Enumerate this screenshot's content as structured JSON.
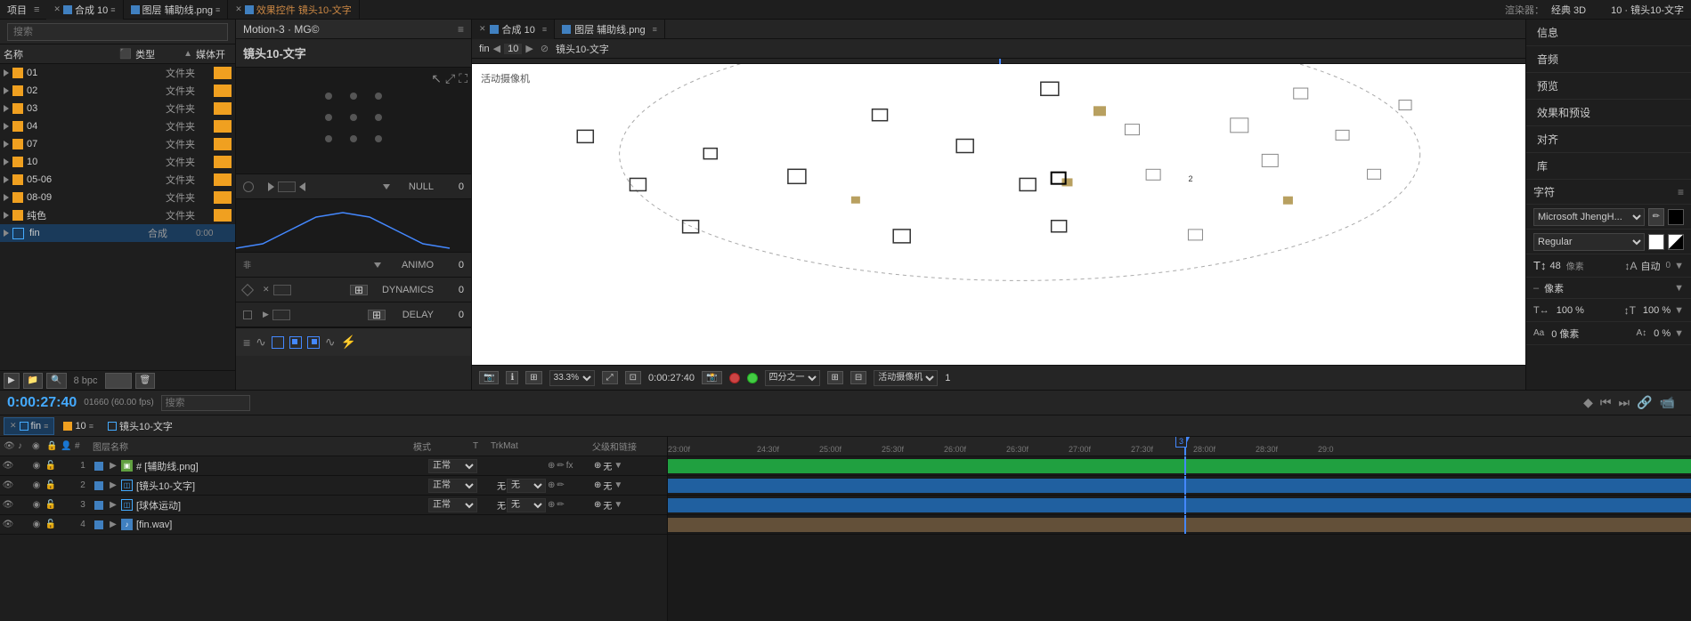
{
  "app": {
    "title": "After Effects"
  },
  "top_tabs": [
    {
      "id": "compose10",
      "label": "合成 10",
      "active": true,
      "icon": "◼"
    },
    {
      "id": "assist_line",
      "label": "图层 辅助线.png",
      "active": false,
      "icon": "◼"
    },
    {
      "id": "effects_lens10",
      "label": "效果控件 镜头10-文字",
      "active": false,
      "icon": "◼"
    }
  ],
  "left_panel": {
    "title": "项目",
    "search_placeholder": "搜索",
    "col_name": "名称",
    "col_type": "类型",
    "col_media": "媒体开",
    "files": [
      {
        "num": "01",
        "name": "01",
        "type": "文件夹",
        "color": "yellow"
      },
      {
        "num": "02",
        "name": "02",
        "type": "文件夹",
        "color": "yellow"
      },
      {
        "num": "03",
        "name": "03",
        "type": "文件夹",
        "color": "yellow"
      },
      {
        "num": "04",
        "name": "04",
        "type": "文件夹",
        "color": "yellow"
      },
      {
        "num": "07",
        "name": "07",
        "type": "文件夹",
        "color": "yellow"
      },
      {
        "num": "10",
        "name": "10",
        "type": "文件夹",
        "color": "yellow"
      },
      {
        "num": "05-06",
        "name": "05-06",
        "type": "文件夹",
        "color": "yellow"
      },
      {
        "num": "08-09",
        "name": "08-09",
        "type": "文件夹",
        "color": "yellow"
      },
      {
        "num": "pure_color",
        "name": "纯色",
        "type": "文件夹",
        "color": "yellow"
      },
      {
        "num": "fin",
        "name": "fin",
        "type": "合成",
        "color": "blue",
        "duration": "0:00"
      }
    ],
    "bottom_info": "8 bpc"
  },
  "motion_panel": {
    "title": "Motion-3 · MG©",
    "comp_name": "镜头10-文字",
    "null_label": "NULL",
    "animo_label": "ANIMO",
    "dynamics_label": "DYNAMICS",
    "delay_label": "DELAY",
    "values": {
      "null_val": "0",
      "animo_val": "0",
      "dynamics_val": "0",
      "delay_val": "0"
    }
  },
  "preview_panel": {
    "tabs": [
      {
        "id": "compose10",
        "label": "合成 10",
        "active": true
      },
      {
        "id": "assist_line",
        "label": "图层 辅助线.png",
        "active": false
      }
    ],
    "toolbar": {
      "fin_label": "fin",
      "frame_num": "10",
      "comp_name": "镜头10-文字",
      "renderer": "渲染器：",
      "renderer_type": "经典 3D",
      "breadcrumb": "10 · 镜头10-文字"
    },
    "canvas_label": "活动摄像机",
    "bottom_bar": {
      "zoom": "33.3%",
      "timecode": "0:00:27:40",
      "quality": "四分之一",
      "camera": "活动摄像机",
      "num": "1"
    }
  },
  "right_panel": {
    "items": [
      {
        "label": "信息"
      },
      {
        "label": "音频"
      },
      {
        "label": "预览"
      },
      {
        "label": "效果和预设"
      },
      {
        "label": "对齐"
      },
      {
        "label": "库"
      }
    ],
    "character_section": {
      "label": "字符",
      "font_name": "Microsoft JhengH...",
      "style": "Regular",
      "size": "48",
      "size_unit": "像素",
      "auto_label": "自动",
      "auto_val": "0",
      "metric1": "像素",
      "percent1": "100 %",
      "percent2": "100 %",
      "pixel_val": "0 像素",
      "zero_pct": "0 %"
    }
  },
  "timeline": {
    "current_time": "0:00:27:40",
    "fps": "01660 (60.00 fps)",
    "tabs": [
      {
        "label": "fin",
        "active": true
      },
      {
        "label": "10",
        "active": false
      },
      {
        "label": "镜头10-文字",
        "active": false
      }
    ],
    "search_placeholder": "搜索",
    "col_headers": {
      "layer_num": "#",
      "layer_name": "图层名称",
      "mode": "模式",
      "t": "T",
      "trkmat": "TrkMat",
      "parent": "父级和链接"
    },
    "layers": [
      {
        "num": "1",
        "name": "[辅助线.png]",
        "mode": "正常",
        "trkmat": "",
        "parent": "无",
        "color": "#4080c0",
        "type": "img"
      },
      {
        "num": "2",
        "name": "[镜头10-文字]",
        "mode": "正常",
        "trkmat": "无",
        "parent": "无",
        "color": "#4080c0",
        "type": "comp"
      },
      {
        "num": "3",
        "name": "[球体运动]",
        "mode": "正常",
        "trkmat": "无",
        "parent": "无",
        "color": "#4080c0",
        "type": "comp"
      },
      {
        "num": "4",
        "name": "[fin.wav]",
        "mode": "",
        "trkmat": "",
        "parent": "",
        "color": "#4080c0",
        "type": "audio"
      }
    ],
    "ruler": {
      "marks": [
        "23:00f",
        "24:30f",
        "25:00f",
        "25:30f",
        "26:00f",
        "26:30f",
        "27:00f",
        "27:30f",
        "28:00f",
        "28:30f",
        "29:0"
      ]
    },
    "playhead_position": "85%"
  },
  "icons": {
    "close": "✕",
    "menu": "≡",
    "search": "🔍",
    "play": "▶",
    "pause": "⏸",
    "expand": "▶",
    "collapse": "▼",
    "settings": "⚙"
  }
}
